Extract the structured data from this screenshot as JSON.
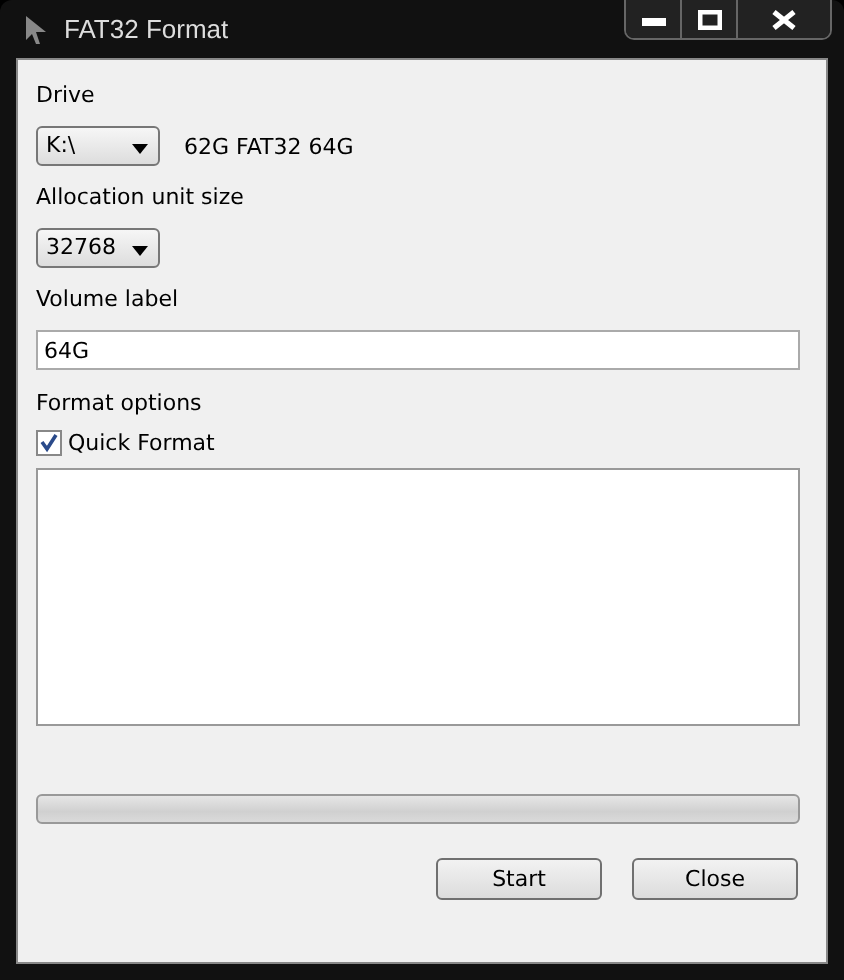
{
  "window": {
    "title": "FAT32 Format"
  },
  "drive": {
    "label": "Drive",
    "value": "K:\\",
    "info": "62G FAT32 64G"
  },
  "allocation": {
    "label": "Allocation unit size",
    "value": "32768"
  },
  "volume": {
    "label": "Volume label",
    "value": "64G"
  },
  "options": {
    "label": "Format options",
    "quick_format": {
      "label": "Quick Format",
      "checked": true
    }
  },
  "progress": {
    "level": 0
  },
  "buttons": [
    "Start",
    "Close"
  ]
}
